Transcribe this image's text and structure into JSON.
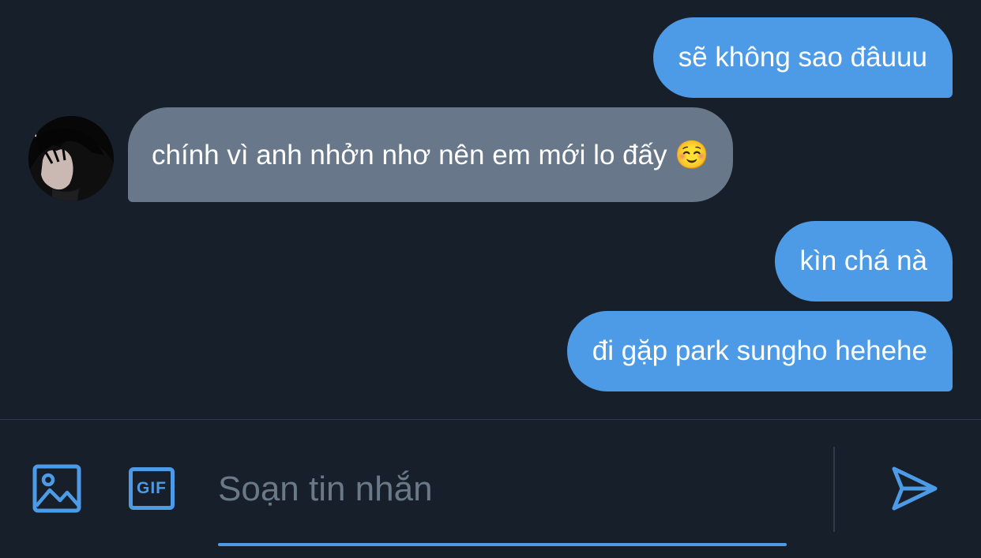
{
  "conversation": {
    "messages": [
      {
        "direction": "outgoing",
        "text": "sẽ không sao đâuuu"
      },
      {
        "direction": "incoming",
        "text": "chính vì anh nhởn nhơ nên em mới lo đấy ☺️"
      },
      {
        "direction": "outgoing",
        "text": "kìn chá nà"
      },
      {
        "direction": "outgoing",
        "text": "đi gặp park sungho hehehe"
      }
    ]
  },
  "composer": {
    "placeholder": "Soạn tin nhắn",
    "gif_label": "GIF",
    "icons": {
      "media": "image-icon",
      "gif": "gif-icon",
      "send": "send-icon"
    }
  },
  "colors": {
    "background": "#161f2a",
    "outgoing_bubble": "#4d9be6",
    "incoming_bubble": "#68788a",
    "accent": "#4d9be6",
    "placeholder": "#6a7987"
  }
}
